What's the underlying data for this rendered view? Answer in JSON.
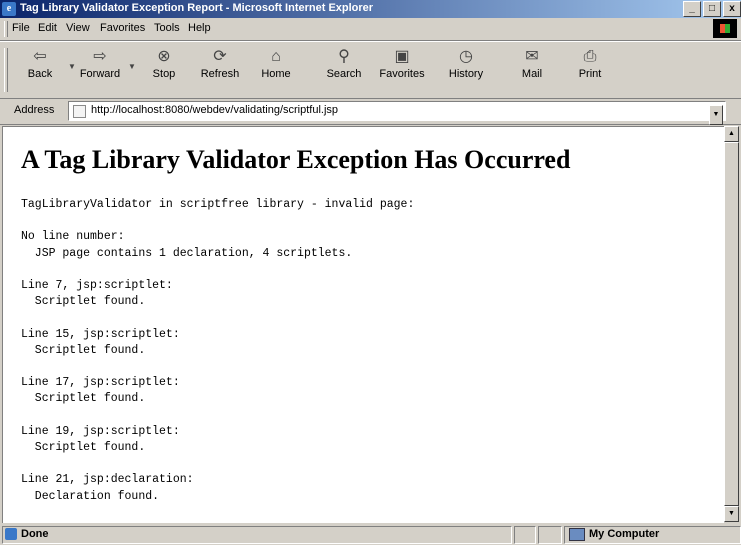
{
  "window": {
    "title": "Tag Library Validator Exception Report - Microsoft Internet Explorer",
    "controls": {
      "minimize": "_",
      "restore": "□",
      "close": "x"
    }
  },
  "menu": {
    "items": [
      {
        "label": "File"
      },
      {
        "label": "Edit"
      },
      {
        "label": "View"
      },
      {
        "label": "Favorites"
      },
      {
        "label": "Tools"
      },
      {
        "label": "Help"
      }
    ]
  },
  "toolbar": {
    "buttons": [
      {
        "label": "Back",
        "icon": "back-arrow-icon"
      },
      {
        "label": "Forward",
        "icon": "forward-arrow-icon"
      },
      {
        "label": "Stop",
        "icon": "stop-icon"
      },
      {
        "label": "Refresh",
        "icon": "refresh-icon"
      },
      {
        "label": "Home",
        "icon": "home-icon"
      },
      {
        "label": "Search",
        "icon": "search-icon"
      },
      {
        "label": "Favorites",
        "icon": "favorites-icon"
      },
      {
        "label": "History",
        "icon": "history-icon"
      },
      {
        "label": "Mail",
        "icon": "mail-icon"
      },
      {
        "label": "Print",
        "icon": "print-icon"
      }
    ]
  },
  "address": {
    "label": "Address",
    "url": "http://localhost:8080/webdev/validating/scriptful.jsp"
  },
  "page": {
    "heading": "A Tag Library Validator Exception Has Occurred",
    "body": "TagLibraryValidator in scriptfree library - invalid page:\n\nNo line number:\n  JSP page contains 1 declaration, 4 scriptlets.\n\nLine 7, jsp:scriptlet:\n  Scriptlet found.\n\nLine 15, jsp:scriptlet:\n  Scriptlet found.\n\nLine 17, jsp:scriptlet:\n  Scriptlet found.\n\nLine 19, jsp:scriptlet:\n  Scriptlet found.\n\nLine 21, jsp:declaration:\n  Declaration found."
  },
  "status": {
    "text": "Done",
    "zone": "My Computer"
  }
}
